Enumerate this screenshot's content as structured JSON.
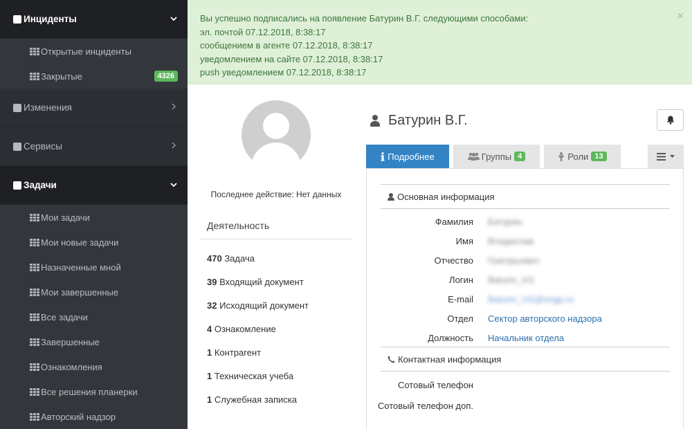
{
  "sidebar": {
    "incidents": {
      "label": "Инциденты",
      "items": [
        {
          "label": "Открытые инциденты"
        },
        {
          "label": "Закрытые",
          "badge": "4326"
        }
      ]
    },
    "changes": {
      "label": "Изменения"
    },
    "services": {
      "label": "Сервисы"
    },
    "tasks": {
      "label": "Задачи",
      "items": [
        {
          "label": "Мои задачи"
        },
        {
          "label": "Мои новые задачи"
        },
        {
          "label": "Назначенные мной"
        },
        {
          "label": "Мои завершенные"
        },
        {
          "label": "Все задачи"
        },
        {
          "label": "Завершенные"
        },
        {
          "label": "Ознакомления"
        },
        {
          "label": "Все решения планерки"
        },
        {
          "label": "Авторский надзор"
        }
      ]
    }
  },
  "alert": {
    "lines": [
      "Вы успешно подписались на появление Батурин В.Г. следующими способами:",
      "эл. почтой 07.12.2018, 8:38:17",
      "сообщением в агенте 07.12.2018, 8:38:17",
      "уведомлением на сайте 07.12.2018, 8:38:17",
      "push уведомлением 07.12.2018, 8:38:17"
    ],
    "close": "×"
  },
  "profile": {
    "last_action": "Последнее действие: Нет данных",
    "activity_title": "Деятельность",
    "activity": [
      {
        "count": "470",
        "label": "Задача"
      },
      {
        "count": "39",
        "label": "Входящий документ"
      },
      {
        "count": "32",
        "label": "Исходящий документ"
      },
      {
        "count": "4",
        "label": "Ознакомление"
      },
      {
        "count": "1",
        "label": "Контрагент"
      },
      {
        "count": "1",
        "label": "Техническая учеба"
      },
      {
        "count": "1",
        "label": "Служебная записка"
      }
    ],
    "name": "Батурин В.Г.",
    "tabs": [
      {
        "label": "Подробнее"
      },
      {
        "label": "Группы",
        "count": "4"
      },
      {
        "label": "Роли",
        "count": "13"
      }
    ],
    "basic_section": "Основная информация",
    "fields": [
      {
        "label": "Фамилия",
        "value": "Батурин"
      },
      {
        "label": "Имя",
        "value": "Владислав"
      },
      {
        "label": "Отчество",
        "value": "Григорьевич"
      },
      {
        "label": "Логин",
        "value": "Baturin_VG"
      },
      {
        "label": "E-mail",
        "value": "Baturin_VG@ongp.ru"
      },
      {
        "label": "Отдел",
        "value": "Сектор авторского надзора"
      },
      {
        "label": "Должность",
        "value": "Начальник отдела"
      }
    ],
    "contact_section": "Контактная информация",
    "contact_fields": [
      {
        "label": "Сотовый телефон",
        "value": ""
      },
      {
        "label": "Сотовый телефон доп.",
        "value": ""
      }
    ]
  },
  "colors": {
    "sidebar_bg": "#2b2e33",
    "sidebar_active_bg": "#1e2024",
    "alert_bg": "#dff0d8",
    "alert_text": "#3c763d",
    "tab_active": "#3384c5",
    "badge_green": "#5cb85c",
    "link": "#2a6fb0"
  }
}
